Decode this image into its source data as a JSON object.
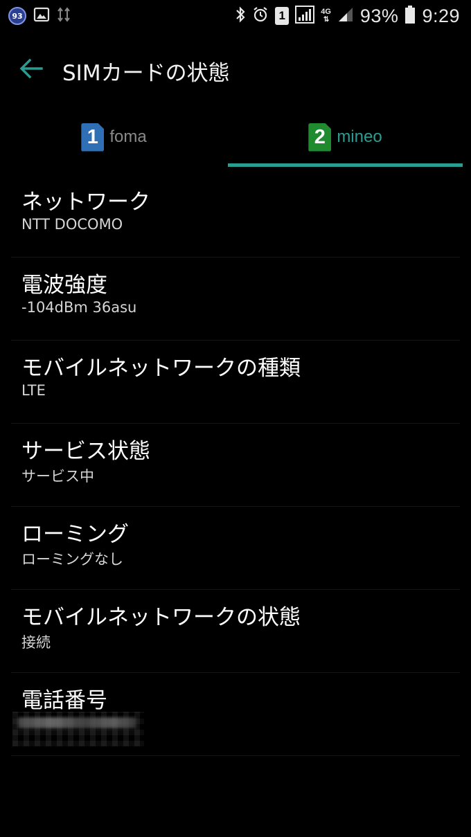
{
  "status_bar": {
    "notification_badge": "93",
    "sim_indicator": "1",
    "network_type": "4G",
    "battery_percent": "93%",
    "time": "9:29",
    "battery_level": 0.93,
    "icons": [
      "gallery-icon",
      "usb-icon",
      "bluetooth-icon",
      "alarm-icon",
      "sim1-icon",
      "signal-icon",
      "4g-icon",
      "signal-icon",
      "battery-icon"
    ]
  },
  "app_bar": {
    "title": "SIMカードの状態",
    "back_icon": "back-arrow-icon"
  },
  "tabs": [
    {
      "number": "1",
      "label": "foma",
      "icon_color": "#2f6fb5",
      "label_color": "#8a8a8a",
      "selected": false
    },
    {
      "number": "2",
      "label": "mineo",
      "icon_color": "#1f8a2e",
      "label_color": "#2a9d92",
      "selected": true
    }
  ],
  "accent_color": "#2a9d92",
  "items": [
    {
      "title": "ネットワーク",
      "value": "NTT DOCOMO"
    },
    {
      "title": "電波強度",
      "value": "-104dBm 36asu"
    },
    {
      "title": "モバイルネットワークの種類",
      "value": "LTE"
    },
    {
      "title": "サービス状態",
      "value": "サービス中"
    },
    {
      "title": "ローミング",
      "value": "ローミングなし"
    },
    {
      "title": "モバイルネットワークの状態",
      "value": "接続"
    },
    {
      "title": "電話番号",
      "value": ""
    }
  ]
}
